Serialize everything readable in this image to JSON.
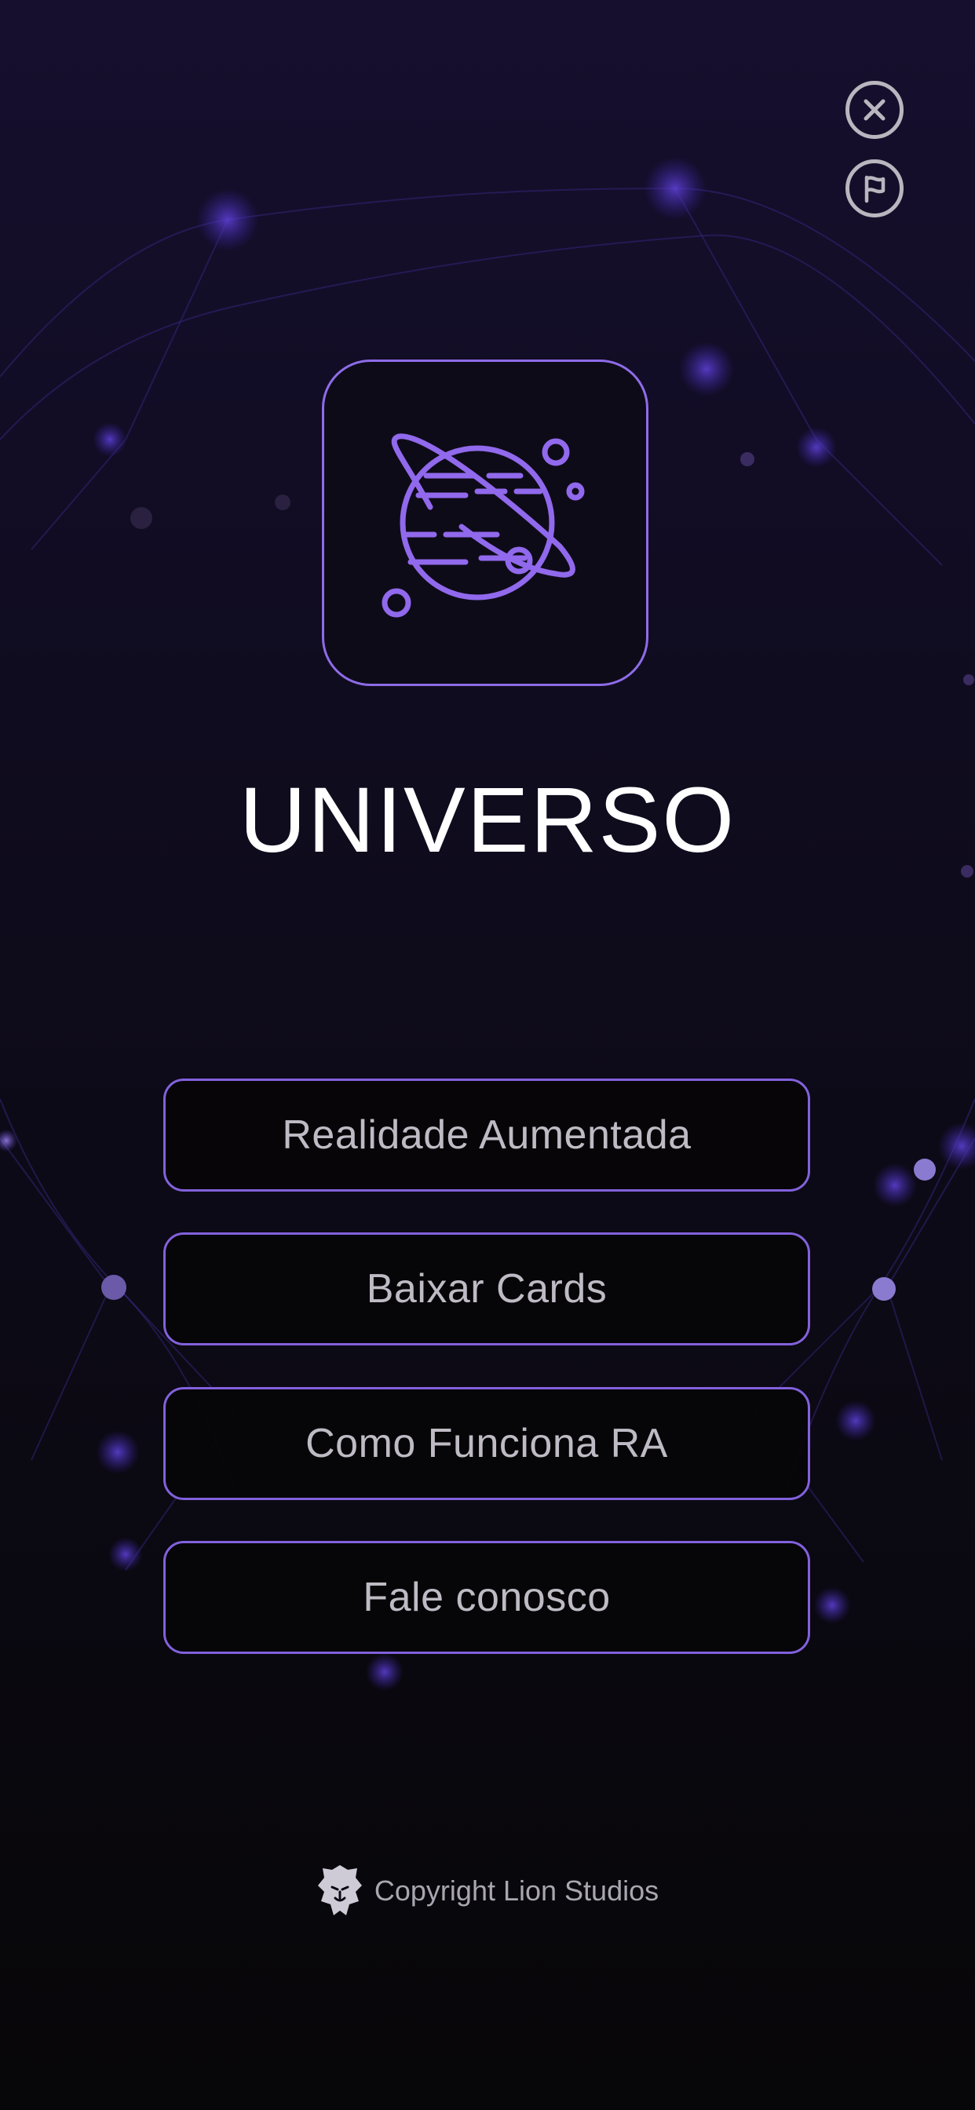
{
  "app": {
    "title": "UNIVERSO",
    "logo_icon": "planet-icon",
    "accent_color": "#8e6ce8"
  },
  "top_actions": {
    "close_icon": "close-icon",
    "flag_icon": "flag-icon"
  },
  "menu": {
    "items": [
      {
        "label": "Realidade Aumentada"
      },
      {
        "label": "Baixar Cards"
      },
      {
        "label": "Como Funciona RA"
      },
      {
        "label": "Fale conosco"
      }
    ]
  },
  "footer": {
    "logo_icon": "lion-icon",
    "copyright": "Copyright Lion Studios"
  }
}
